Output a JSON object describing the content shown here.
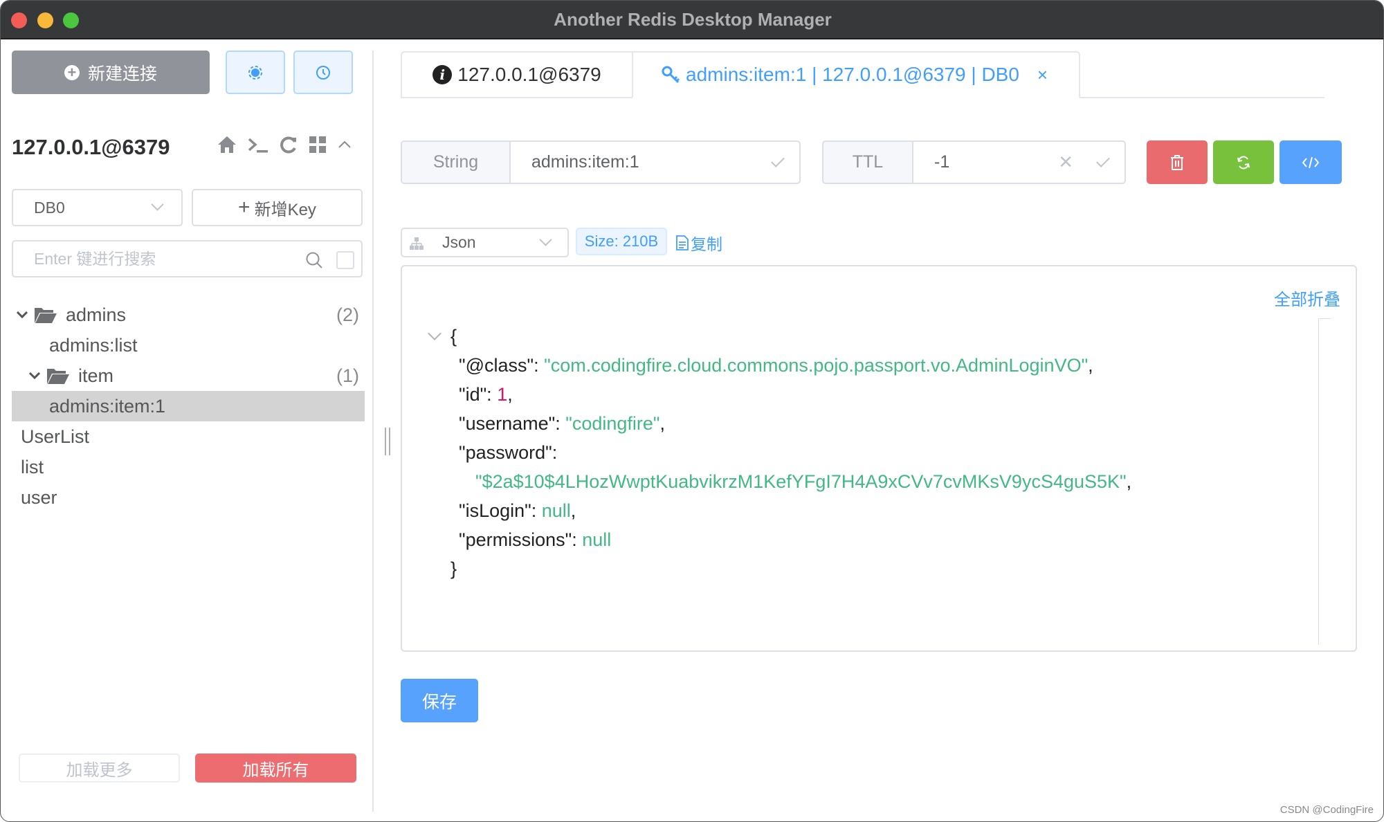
{
  "window": {
    "title": "Another Redis Desktop Manager",
    "controls": [
      "close",
      "minimize",
      "maximize"
    ]
  },
  "sidebar": {
    "new_connection_label": "新建连接",
    "settings_icon": "gear-icon",
    "history_icon": "clock-icon",
    "connection": {
      "name": "127.0.0.1@6379",
      "toolbar_icons": [
        "home-icon",
        "terminal-icon",
        "refresh-icon",
        "grid-icon",
        "chevron-up-icon"
      ]
    },
    "db_select": {
      "value": "DB0"
    },
    "add_key_label": "新增Key",
    "search": {
      "placeholder": "Enter 键进行搜索",
      "value": ""
    },
    "tree": [
      {
        "type": "folder",
        "label": "admins",
        "count": "(2)",
        "expanded": true,
        "depth": 0
      },
      {
        "type": "key",
        "label": "admins:list",
        "depth": 1
      },
      {
        "type": "folder",
        "label": "item",
        "count": "(1)",
        "expanded": true,
        "depth": 1
      },
      {
        "type": "key",
        "label": "admins:item:1",
        "depth": 2,
        "selected": true
      },
      {
        "type": "key",
        "label": "UserList",
        "depth": 0
      },
      {
        "type": "key",
        "label": "list",
        "depth": 0
      },
      {
        "type": "key",
        "label": "user",
        "depth": 0
      }
    ],
    "load_more_label": "加载更多",
    "load_all_label": "加载所有"
  },
  "tabs": [
    {
      "icon": "info-icon",
      "label": "127.0.0.1@6379",
      "active": false
    },
    {
      "icon": "key-icon",
      "label": "admins:item:1 | 127.0.0.1@6379 | DB0",
      "active": true,
      "closable": true
    }
  ],
  "key_detail": {
    "type": "String",
    "key_name": "admins:item:1",
    "ttl_label": "TTL",
    "ttl_value": "-1",
    "actions": [
      "delete-icon",
      "refresh-icon",
      "code-icon"
    ],
    "format": "Json",
    "size_label": "Size: 210B",
    "copy_label": "复制",
    "collapse_all_label": "全部折叠",
    "json": {
      "open": "{",
      "close": "}",
      "fields": [
        {
          "key": "\"@class\"",
          "value": "\"com.codingfire.cloud.commons.pojo.passport.vo.AdminLoginVO\"",
          "kind": "string",
          "comma": true
        },
        {
          "key": "\"id\"",
          "value": "1",
          "kind": "number",
          "comma": true
        },
        {
          "key": "\"username\"",
          "value": "\"codingfire\"",
          "kind": "string",
          "comma": true
        },
        {
          "key": "\"password\"",
          "value": "\"$2a$10$4LHozWwptKuabvikrzM1KefYFgI7H4A9xCVv7cvMKsV9ycS4guS5K\"",
          "kind": "string",
          "comma": true,
          "wrapped": true
        },
        {
          "key": "\"isLogin\"",
          "value": "null",
          "kind": "null",
          "comma": true
        },
        {
          "key": "\"permissions\"",
          "value": "null",
          "kind": "null",
          "comma": false
        }
      ]
    },
    "save_label": "保存"
  },
  "watermark": "CSDN @CodingFire",
  "colors": {
    "primary": "#409eff",
    "danger": "#ea6b6e",
    "success": "#77c13d",
    "string_value": "#42b983",
    "number_value": "#e0115f"
  }
}
